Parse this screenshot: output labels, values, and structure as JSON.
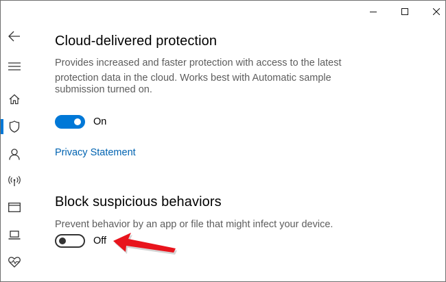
{
  "nav": {
    "items": [
      {
        "icon": "back-arrow-icon"
      },
      {
        "icon": "hamburger-menu-icon"
      },
      {
        "icon": "home-icon"
      },
      {
        "icon": "shield-icon"
      },
      {
        "icon": "person-icon"
      },
      {
        "icon": "wireless-antenna-icon"
      },
      {
        "icon": "browser-window-icon"
      },
      {
        "icon": "laptop-icon"
      },
      {
        "icon": "heart-pulse-icon"
      }
    ],
    "active_index": 3,
    "accent": "#0078d7"
  },
  "window_controls": [
    "minimize-icon",
    "maximize-icon",
    "close-icon"
  ],
  "cloud": {
    "title": "Cloud-delivered protection",
    "desc_line1": "Provides increased and faster protection with access to the latest",
    "desc_line2": "protection data in the cloud.  Works best with Automatic sample",
    "desc_line3": "submission turned on.",
    "toggle_state": "on",
    "toggle_label": "On",
    "privacy_link": "Privacy Statement"
  },
  "block": {
    "title": "Block suspicious behaviors",
    "desc": "Prevent behavior by an app or file that might infect your device.",
    "toggle_state": "off",
    "toggle_label": "Off"
  },
  "annotation": {
    "icon": "red-arrow-icon",
    "color": "#e8141c"
  }
}
